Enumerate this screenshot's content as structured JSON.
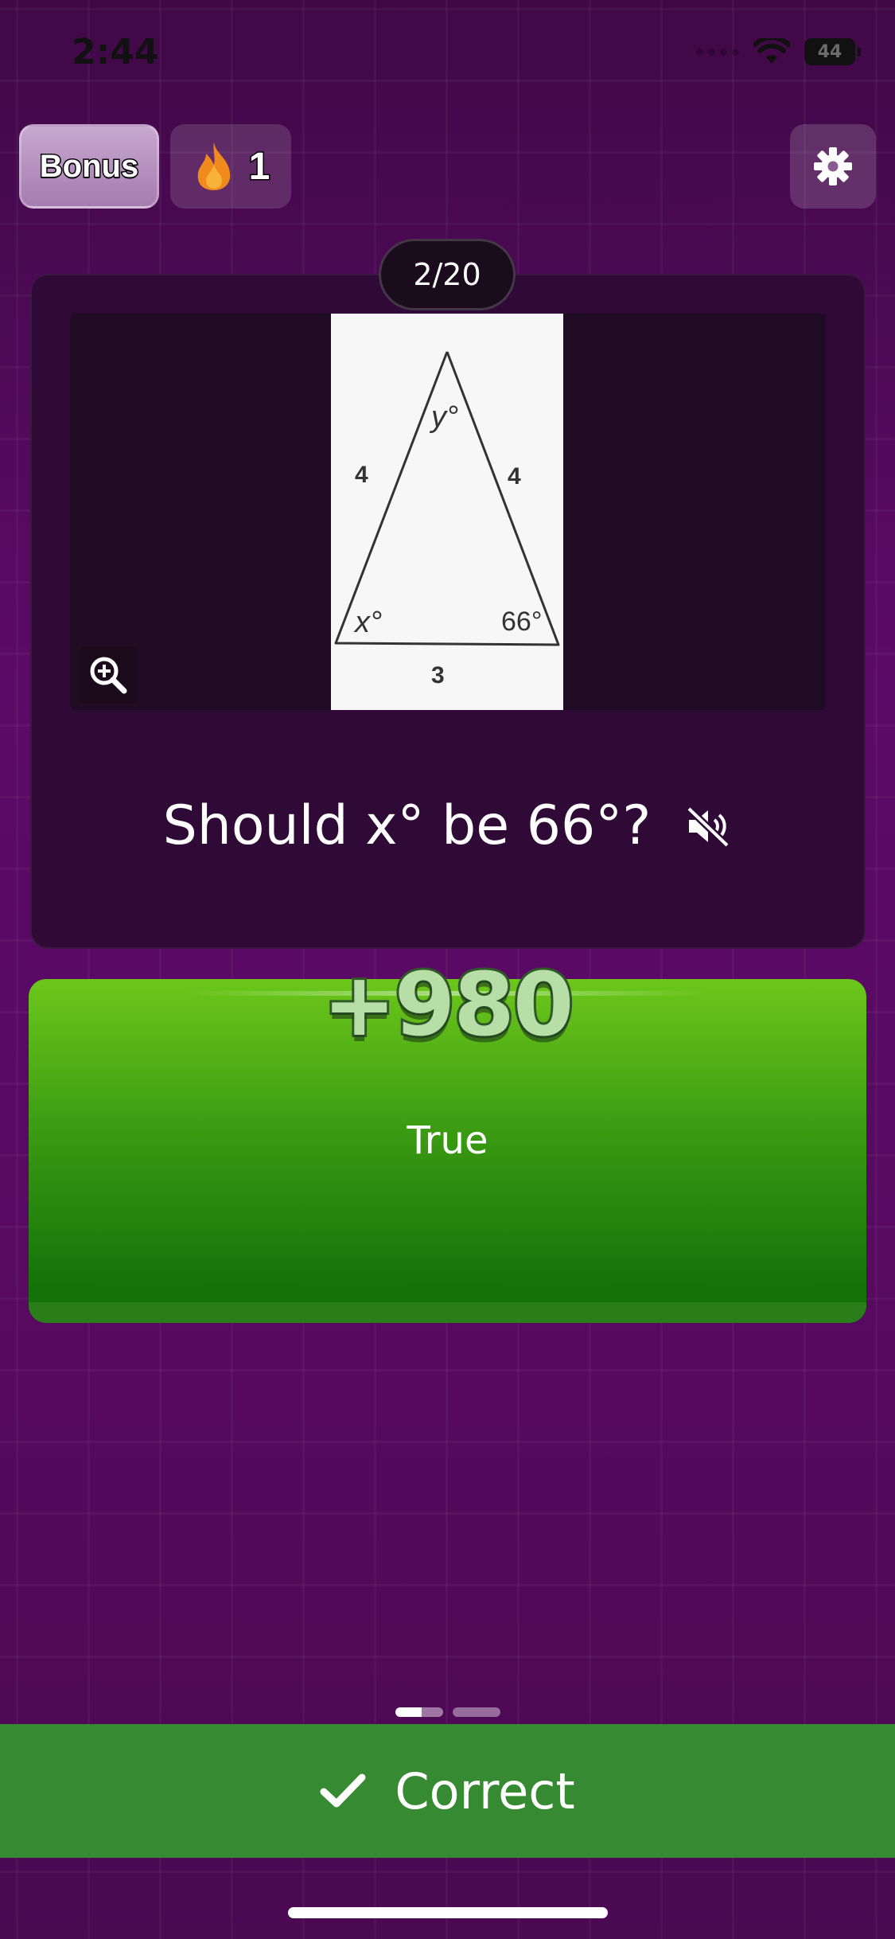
{
  "status_bar": {
    "time": "2:44",
    "battery": "44"
  },
  "top_bar": {
    "bonus_label": "Bonus",
    "streak_count": "1"
  },
  "question": {
    "counter": "2/20",
    "text": "Should x° be 66°?",
    "figure": {
      "side_left": "4",
      "side_right": "4",
      "base": "3",
      "angle_top": "y°",
      "angle_left": "x°",
      "angle_right": "66°"
    }
  },
  "answer": {
    "label": "True",
    "points": "+980"
  },
  "pager": {
    "total": 2,
    "current": 1
  },
  "feedback": {
    "label": "Correct"
  },
  "colors": {
    "correct": "#368a31",
    "answer_green": "#4aa815",
    "background": "#56095d"
  }
}
